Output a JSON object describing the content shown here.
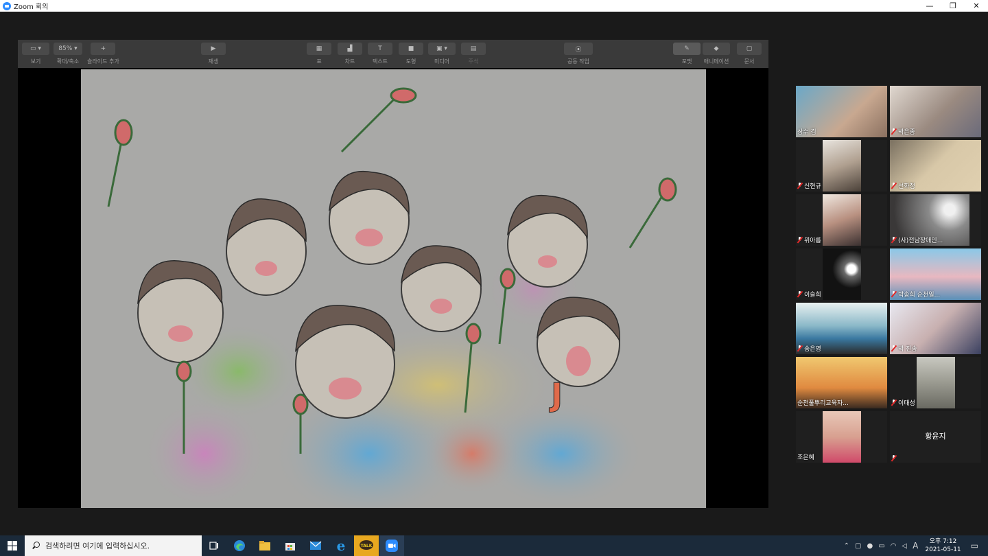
{
  "window": {
    "title": "Zoom 회의",
    "controls": [
      "—",
      "❐",
      "✕"
    ]
  },
  "toolbar": {
    "items": [
      {
        "label": "보기",
        "button": "▭ ▾"
      },
      {
        "label": "확대/축소",
        "button": "85% ▾"
      },
      {
        "label": "슬라이드 추가",
        "button": "+"
      },
      {
        "label": "재생",
        "button": "▶"
      },
      {
        "label": "표",
        "button": "▦"
      },
      {
        "label": "차트",
        "button": "▟"
      },
      {
        "label": "텍스트",
        "button": "T"
      },
      {
        "label": "도형",
        "button": "■"
      },
      {
        "label": "미디어",
        "button": "▣ ▾"
      },
      {
        "label": "주석",
        "button": "▤"
      },
      {
        "label": "공동 작업",
        "button": "⦿"
      },
      {
        "label": "포맷",
        "button": "✎"
      },
      {
        "label": "애니메이션",
        "button": "◆"
      },
      {
        "label": "문서",
        "button": "▢"
      }
    ]
  },
  "participants": [
    {
      "name": "상수 김",
      "muted": false
    },
    {
      "name": "박은종",
      "muted": true
    },
    {
      "name": "신현규",
      "muted": true
    },
    {
      "name": "선화정",
      "muted": true
    },
    {
      "name": "위아름",
      "muted": true
    },
    {
      "name": "(사)전남장애인...",
      "muted": true
    },
    {
      "name": "이슬희",
      "muted": true
    },
    {
      "name": "박송희 순천일...",
      "muted": true
    },
    {
      "name": "송은영",
      "muted": true
    },
    {
      "name": "박 진송",
      "muted": true
    },
    {
      "name": "순천풀뿌리교육자...",
      "muted": false
    },
    {
      "name": "이태성",
      "muted": true
    },
    {
      "name": "조은혜",
      "muted": false
    },
    {
      "name": "황윤지",
      "muted": true
    }
  ],
  "taskbar": {
    "search_placeholder": "검색하려면 여기에 입력하십시오.",
    "tray_lang": "A",
    "clock_time": "오후 7:12",
    "clock_date": "2021-05-11"
  },
  "colors": {
    "active_speaker": "#e8e86a",
    "taskbar": "#1b2a3a",
    "zoom_blue": "#2d8cff"
  }
}
